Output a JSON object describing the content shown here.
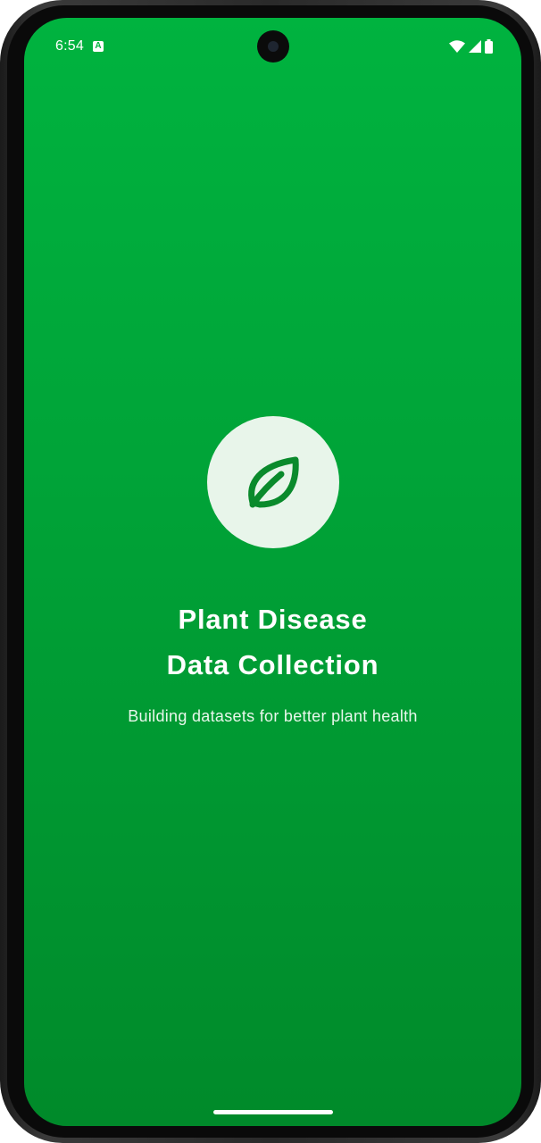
{
  "status_bar": {
    "time": "6:54",
    "a_icon_letter": "A",
    "icons": [
      "wifi-icon",
      "cellular-signal-icon",
      "battery-icon"
    ]
  },
  "splash": {
    "logo_icon": "leaf-icon",
    "title_line1": "Plant Disease",
    "title_line2": "Data Collection",
    "subtitle": "Building datasets for better plant health"
  },
  "colors": {
    "background_top": "#00b33f",
    "background_bottom": "#008a2a",
    "logo_circle": "#e8f5ea",
    "leaf": "#0a8a2c",
    "text": "#ffffff"
  }
}
